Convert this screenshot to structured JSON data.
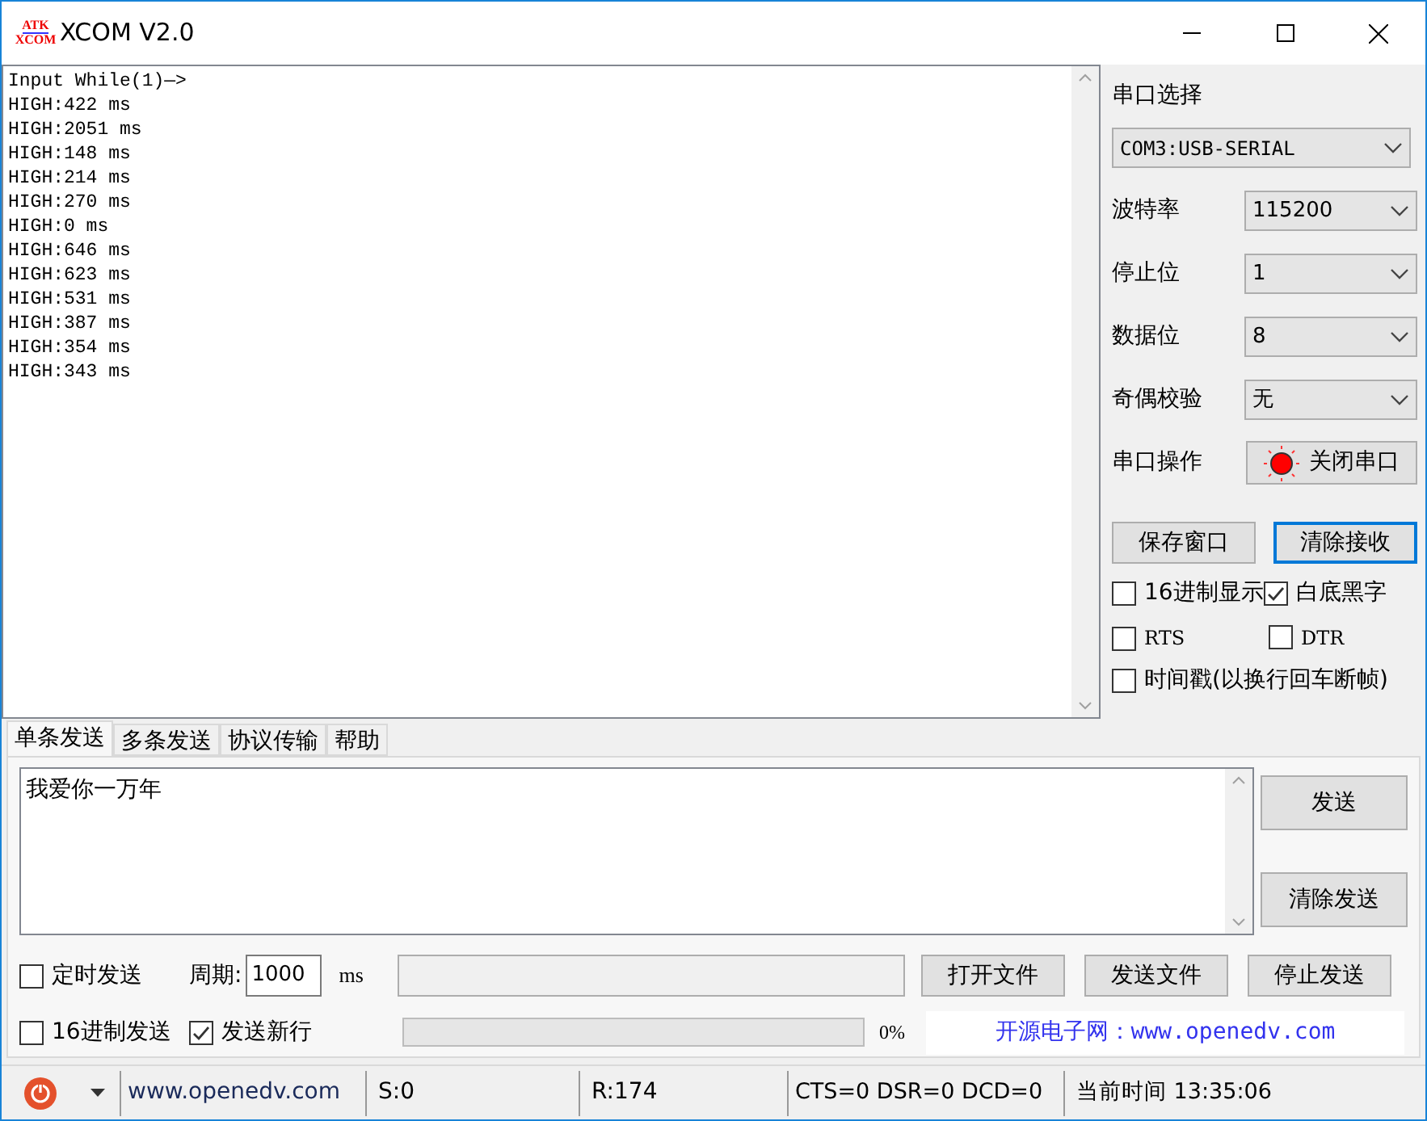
{
  "window": {
    "title": "XCOM V2.0",
    "logo_top": "ATK",
    "logo_bottom": "XCOM"
  },
  "receive": {
    "lines": [
      "Input While(1)—>",
      "HIGH:422 ms",
      "HIGH:2051 ms",
      "HIGH:148 ms",
      "HIGH:214 ms",
      "HIGH:270 ms",
      "HIGH:0 ms",
      "HIGH:646 ms",
      "HIGH:623 ms",
      "HIGH:531 ms",
      "HIGH:387 ms",
      "HIGH:354 ms",
      "HIGH:343 ms"
    ]
  },
  "serial": {
    "port_label": "串口选择",
    "port_value": "COM3:USB-SERIAL",
    "settings": [
      {
        "label": "波特率",
        "value": "115200"
      },
      {
        "label": "停止位",
        "value": "1"
      },
      {
        "label": "数据位",
        "value": "8"
      },
      {
        "label": "奇偶校验",
        "value": "无"
      }
    ],
    "operation": {
      "label": "串口操作",
      "button": "关闭串口",
      "open": true
    },
    "buttons": [
      {
        "label": "保存窗口",
        "focused": false
      },
      {
        "label": "清除接收",
        "focused": true
      }
    ],
    "options": [
      {
        "label": "16进制显示",
        "checked": false
      },
      {
        "label": "白底黑字",
        "checked": true
      },
      {
        "label": "RTS",
        "checked": false
      },
      {
        "label": "DTR",
        "checked": false
      },
      {
        "label": "时间戳(以换行回车断帧)",
        "checked": false
      }
    ]
  },
  "tabs": [
    {
      "label": "单条发送",
      "selected": true
    },
    {
      "label": "多条发送",
      "selected": false
    },
    {
      "label": "协议传输",
      "selected": false
    },
    {
      "label": "帮助",
      "selected": false
    }
  ],
  "send": {
    "text": "我爱你一万年",
    "send_button": "发送",
    "clear_button": "清除发送",
    "timed": {
      "label": "定时发送",
      "checked": false
    },
    "period_label": "周期:",
    "period_value": "1000",
    "period_unit": "ms",
    "hex_send": {
      "label": "16进制发送",
      "checked": false
    },
    "newline": {
      "label": "发送新行",
      "checked": true
    },
    "file_buttons": [
      "打开文件",
      "发送文件",
      "停止发送"
    ],
    "progress": {
      "level": 0,
      "reading": "0%"
    },
    "banner": "开源电子网：www.openedv.com"
  },
  "status_bar": {
    "website": "www.openedv.com",
    "sent": "S:0",
    "received": "R:174",
    "lines": "CTS=0 DSR=0 DCD=0",
    "time": "当前时间 13:35:06"
  }
}
